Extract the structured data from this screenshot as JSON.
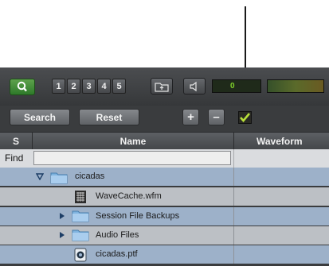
{
  "toolbar": {
    "number_buttons": [
      "1",
      "2",
      "3",
      "4",
      "5"
    ],
    "meter_value": "0"
  },
  "actions": {
    "search_label": "Search",
    "reset_label": "Reset",
    "add_label": "+",
    "remove_label": "–"
  },
  "columns": {
    "s": "S",
    "name": "Name",
    "waveform": "Waveform"
  },
  "find": {
    "label": "Find",
    "value": ""
  },
  "files": [
    {
      "name": "cicadas",
      "type": "folder",
      "expanded": true
    },
    {
      "name": "WaveCache.wfm",
      "type": "wavecache-file"
    },
    {
      "name": "Session File Backups",
      "type": "folder",
      "expanded": false
    },
    {
      "name": "Audio Files",
      "type": "folder",
      "expanded": false
    },
    {
      "name": "cicadas.ptf",
      "type": "session-file"
    }
  ],
  "colors": {
    "checkbox_check": "#b8e03a",
    "row_blue": "#9db1c9",
    "row_gray": "#bcc0c5",
    "search_button": "#3f8c36"
  }
}
